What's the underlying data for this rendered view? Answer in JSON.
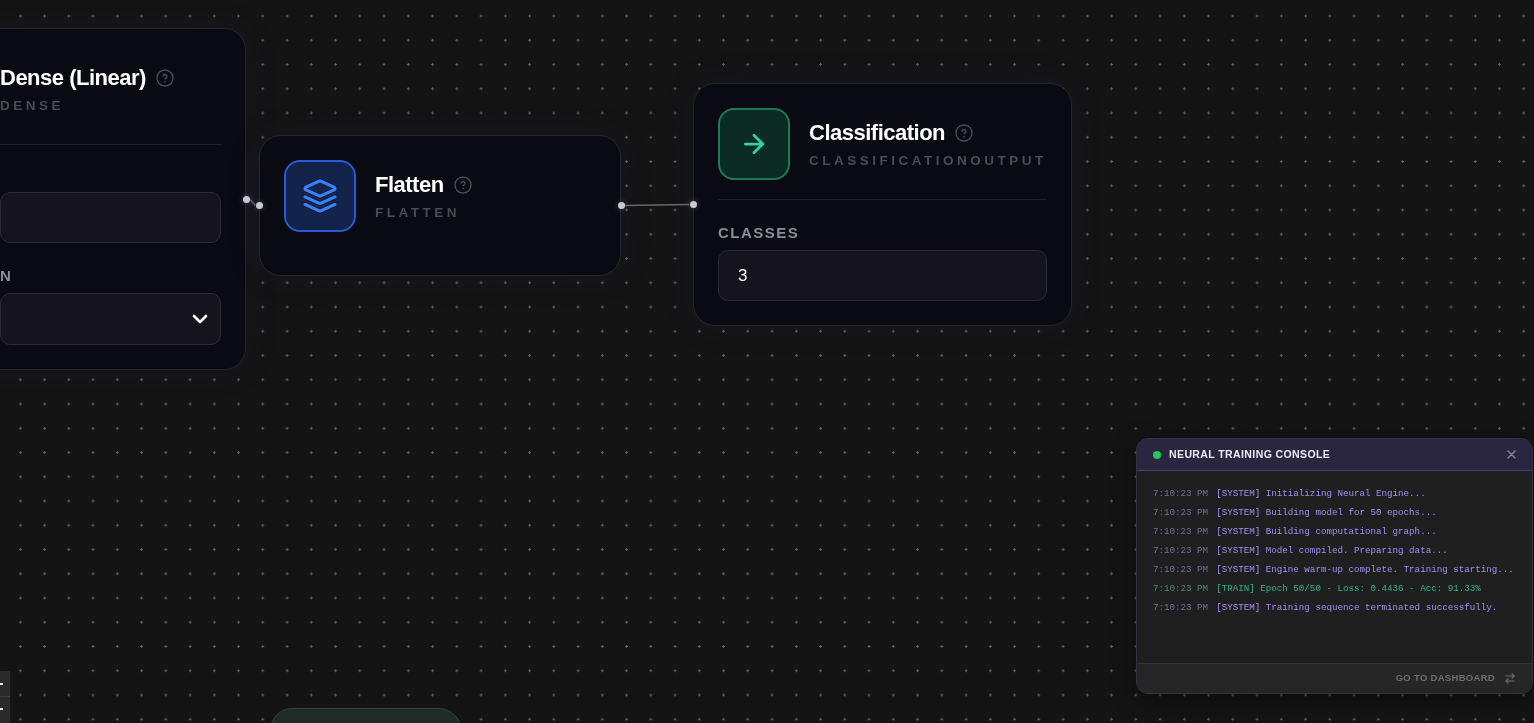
{
  "canvas": {
    "nodes": [
      {
        "kind": "dense",
        "title": "Dense (Linear)",
        "type_label": "DENSE",
        "linked_to_next": true,
        "fields": [
          {
            "kind": "input"
          },
          {
            "kind": "select",
            "label": "N"
          }
        ]
      },
      {
        "kind": "flatten",
        "title": "Flatten",
        "type_label": "FLATTEN",
        "linked_to_next": true
      },
      {
        "kind": "output",
        "title": "Classification",
        "type_label": "CLASSIFICATIONOUTPUT",
        "linked_to_next": false,
        "fields": [
          {
            "kind": "input",
            "label": "CLASSES",
            "value": "3"
          }
        ]
      },
      {
        "kind": "partial"
      }
    ]
  },
  "console": {
    "title": "NEURAL TRAINING CONSOLE",
    "connected": true,
    "logs": [
      {
        "kind": "system",
        "time": "7:10:23 PM",
        "text": "[SYSTEM] Initializing Neural Engine..."
      },
      {
        "kind": "system",
        "time": "7:10:23 PM",
        "text": "[SYSTEM] Building model for 50 epochs..."
      },
      {
        "kind": "system",
        "time": "7:10:23 PM",
        "text": "[SYSTEM] Building computational graph..."
      },
      {
        "kind": "system",
        "time": "7:10:23 PM",
        "text": "[SYSTEM] Model compiled. Preparing data..."
      },
      {
        "kind": "system",
        "time": "7:10:23 PM",
        "text": "[SYSTEM] Engine warm-up complete. Training starting..."
      },
      {
        "kind": "train",
        "time": "7:10:23 PM",
        "text": "[TRAIN] Epoch 50/50 - Loss: 0.4436 - Acc: 91.33%"
      },
      {
        "kind": "system",
        "time": "7:10:23 PM",
        "text": "[SYSTEM] Training sequence terminated successfully."
      }
    ],
    "footer_link": "GO TO DASHBOARD"
  }
}
